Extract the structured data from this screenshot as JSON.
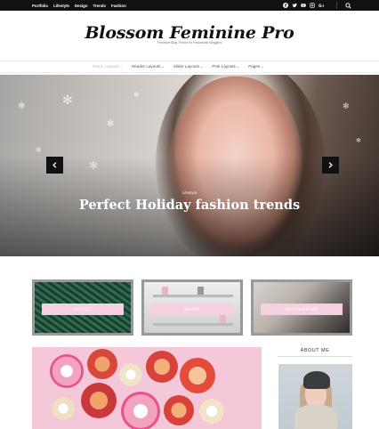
{
  "topbar": {
    "nav": [
      "Portfolio",
      "Lifestyle",
      "Design",
      "Trends",
      "Fashion"
    ],
    "social_icons": [
      "facebook-icon",
      "twitter-icon",
      "youtube-icon",
      "instagram-icon",
      "google-plus-icon"
    ],
    "search_icon": "search-icon"
  },
  "header": {
    "title": "Blossom Feminine Pro",
    "tagline": "Feminine Blog Theme for Passionate Bloggers"
  },
  "mainnav": {
    "items": [
      "Home Layouts",
      "Header Layouts",
      "Slider Layouts",
      "Post Layouts",
      "Pages"
    ]
  },
  "hero": {
    "category": "Lifestyle",
    "title": "Perfect Holiday fashion trends",
    "prev_icon": "chevron-left-icon",
    "next_icon": "chevron-right-icon"
  },
  "promos": [
    {
      "label": "ABOUT"
    },
    {
      "label": "SHOP"
    },
    {
      "label": "INSTAGRAM"
    }
  ],
  "sidebar": {
    "about_title": "ABOUT ME"
  },
  "colors": {
    "topbar_bg": "#111111",
    "promo_label_bg": "#f6cfe0",
    "fruit_bg": "#f4c8d8"
  }
}
